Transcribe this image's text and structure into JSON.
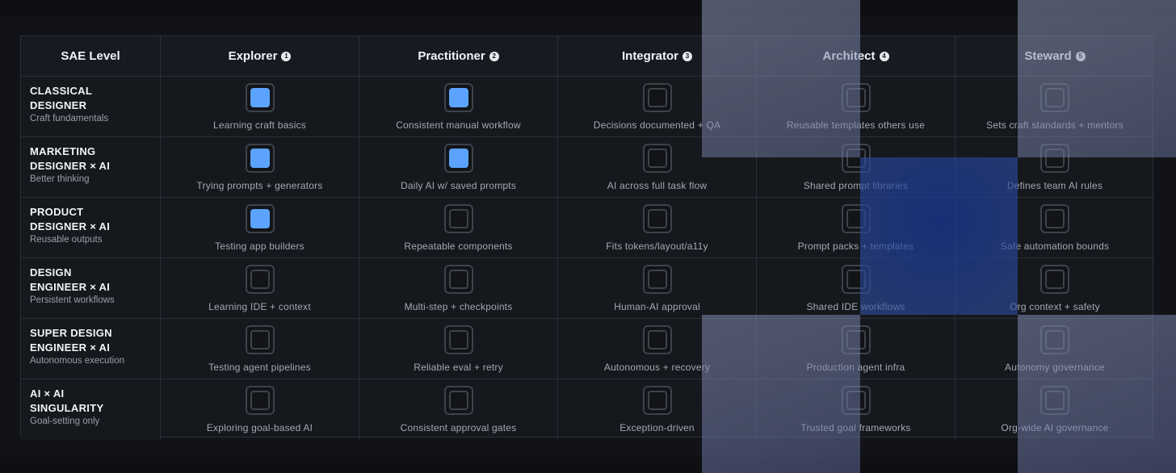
{
  "header": {
    "first": "SAE Level",
    "levels": [
      {
        "label": "Explorer",
        "num": "1"
      },
      {
        "label": "Practitioner",
        "num": "2"
      },
      {
        "label": "Integrator",
        "num": "3"
      },
      {
        "label": "Architect",
        "num": "4"
      },
      {
        "label": "Steward",
        "num": "5"
      }
    ]
  },
  "accent_color": "#5ba3ff",
  "rows": [
    {
      "title_line1": "CLASSICAL",
      "title_line2": "DESIGNER",
      "subtitle": "Craft fundamentals",
      "cells": [
        {
          "caption": "Learning craft basics",
          "checked": true
        },
        {
          "caption": "Consistent manual workflow",
          "checked": true
        },
        {
          "caption": "Decisions documented + QA",
          "checked": false
        },
        {
          "caption": "Reusable templates others use",
          "checked": false
        },
        {
          "caption": "Sets craft standards + mentors",
          "checked": false
        }
      ]
    },
    {
      "title_line1": "MARKETING",
      "title_line2": "DESIGNER × AI",
      "subtitle": "Better thinking",
      "cells": [
        {
          "caption": "Trying prompts + generators",
          "checked": true
        },
        {
          "caption": "Daily AI w/ saved prompts",
          "checked": true
        },
        {
          "caption": "AI across full task flow",
          "checked": false
        },
        {
          "caption": "Shared prompt libraries",
          "checked": false
        },
        {
          "caption": "Defines team AI rules",
          "checked": false
        }
      ]
    },
    {
      "title_line1": "PRODUCT",
      "title_line2": "DESIGNER × AI",
      "subtitle": "Reusable outputs",
      "cells": [
        {
          "caption": "Testing app builders",
          "checked": true
        },
        {
          "caption": "Repeatable components",
          "checked": false
        },
        {
          "caption": "Fits tokens/layout/a11y",
          "checked": false
        },
        {
          "caption": "Prompt packs + templates",
          "checked": false
        },
        {
          "caption": "Safe automation bounds",
          "checked": false
        }
      ]
    },
    {
      "title_line1": "DESIGN",
      "title_line2": "ENGINEER × AI",
      "subtitle": "Persistent workflows",
      "cells": [
        {
          "caption": "Learning IDE + context",
          "checked": false
        },
        {
          "caption": "Multi-step + checkpoints",
          "checked": false
        },
        {
          "caption": "Human-AI approval",
          "checked": false
        },
        {
          "caption": "Shared IDE workflows",
          "checked": false
        },
        {
          "caption": "Org context + safety",
          "checked": false
        }
      ]
    },
    {
      "title_line1": "SUPER DESIGN",
      "title_line2": "ENGINEER × AI",
      "subtitle": "Autonomous execution",
      "cells": [
        {
          "caption": "Testing agent pipelines",
          "checked": false
        },
        {
          "caption": "Reliable eval + retry",
          "checked": false
        },
        {
          "caption": "Autonomous + recovery",
          "checked": false
        },
        {
          "caption": "Production agent infra",
          "checked": false
        },
        {
          "caption": "Autonomy governance",
          "checked": false
        }
      ]
    },
    {
      "title_line1": "AI × AI",
      "title_line2": "SINGULARITY",
      "subtitle": "Goal-setting only",
      "cells": [
        {
          "caption": "Exploring goal-based AI",
          "checked": false
        },
        {
          "caption": "Consistent approval gates",
          "checked": false
        },
        {
          "caption": "Exception-driven",
          "checked": false
        },
        {
          "caption": "Trusted goal frameworks",
          "checked": false
        },
        {
          "caption": "Org-wide AI governance",
          "checked": false
        }
      ]
    }
  ]
}
